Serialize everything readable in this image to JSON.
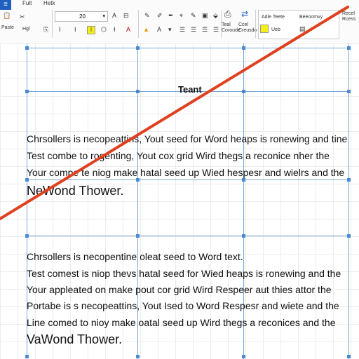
{
  "ribbon": {
    "app_button": "≡",
    "tabs": [
      "Fult",
      "Hetk"
    ],
    "paste_label": "Paste",
    "hash_label": "Hgl",
    "font_size_value": "20",
    "style_gallery_label": "Adle Teete",
    "style_label_2": "Beeoomvy",
    "style_label_3": "Ueb",
    "group_label_1": "Teal\nCoroude",
    "group_label_2": "Ccel\nCreusdo",
    "group_label_3": "Recel\nRcess"
  },
  "document": {
    "title": "Teant",
    "block1": [
      "Chrsollers is necopeattins, Yout seed for Word heaps is ronewing and tine",
      "Test combe to rogenting, Yout cox grid Wird thegs a reconice nher the",
      "Your compe te niog make hatal seed up Wied hespesr and wielrs and the"
    ],
    "block1_footer": "NeWond Thower.",
    "block2": [
      "Chrsollers is necopentine oleat seed to Word text.",
      "Test comest is niop thevs hatal seed for Wied heaps is ronewing and the",
      "Your appleated on make pout cor grid Wird Respeer aut thies attor the",
      "Portabe is s necopeattins, Yout Ised to Word Respesr and wiete and the",
      "Line comed to nioy make oatal seed up Wird thegs a reconices and the"
    ],
    "block2_footer": "VaWond Thower."
  },
  "annotation": {
    "line_color": "#e0401f"
  }
}
